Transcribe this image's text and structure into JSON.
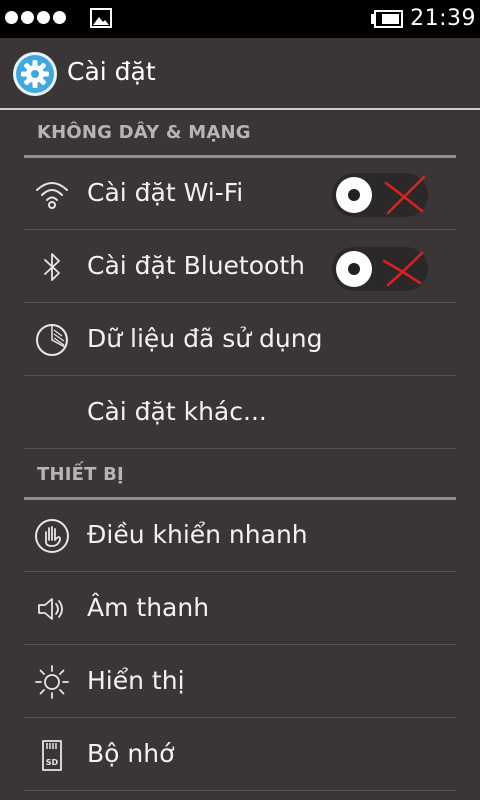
{
  "status_bar": {
    "time": "21:39",
    "icons": [
      "signal-dots-icon",
      "gallery-icon",
      "battery-icon"
    ]
  },
  "action_bar": {
    "icon": "settings-gear-icon",
    "title": "Cài đặt"
  },
  "sections": {
    "wireless": {
      "header": "KHÔNG DÂY & MẠNG",
      "items": [
        {
          "label": "Cài đặt Wi-Fi",
          "icon": "wifi-icon",
          "toggle": "off"
        },
        {
          "label": "Cài đặt Bluetooth",
          "icon": "bluetooth-icon",
          "toggle": "off"
        },
        {
          "label": "Dữ liệu đã sử dụng",
          "icon": "data-usage-icon"
        },
        {
          "label": "Cài đặt khác..."
        }
      ]
    },
    "device": {
      "header": "THIẾT BỊ",
      "items": [
        {
          "label": "Điều khiển nhanh",
          "icon": "hand-gesture-icon"
        },
        {
          "label": "Âm thanh",
          "icon": "speaker-icon"
        },
        {
          "label": "Hiển thị",
          "icon": "brightness-icon"
        },
        {
          "label": "Bộ nhớ",
          "icon": "sd-card-icon"
        }
      ]
    }
  },
  "colors": {
    "background": "#3a3637",
    "status_bar": "#000000",
    "section_header_text": "#b5b5b5",
    "toggle_off_mark": "#e02020",
    "app_icon": "#3fa8e0"
  }
}
